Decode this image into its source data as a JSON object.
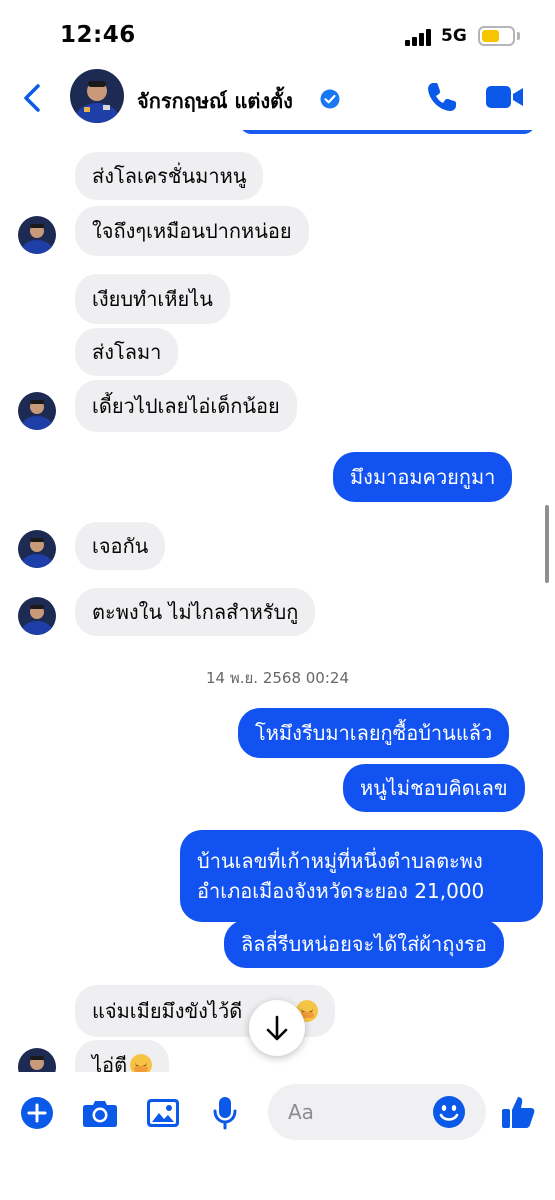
{
  "status_bar": {
    "time": "12:46",
    "network": "5G",
    "battery_level": 0.6
  },
  "header": {
    "contact_name": "จักรกฤษณ์ แต่งตั้ง",
    "verified": true
  },
  "messages": [
    {
      "dir": "in",
      "text": "ส่งโลเครชั่นมาหนู"
    },
    {
      "dir": "in",
      "text": "ใจถึงๆเหมือนปากหน่อย"
    },
    {
      "dir": "in",
      "text": "เงียบทำเหียไน"
    },
    {
      "dir": "in",
      "text": "ส่งโลมา"
    },
    {
      "dir": "in",
      "text": "เดี้ยวไปเลยไอ่เด็กน้อย"
    },
    {
      "dir": "out",
      "text": "มึงมาอมควยกูมา"
    },
    {
      "dir": "in",
      "text": "เจอกัน"
    },
    {
      "dir": "in",
      "text": "ตะพงใน  ไม่ไกลสำหรับกู"
    },
    {
      "dir": "out",
      "text": "โหมึงรีบมาเลยกูซื้อบ้านแล้ว"
    },
    {
      "dir": "out",
      "text": "หนูไม่ชอบคิดเลข"
    },
    {
      "dir": "out",
      "line1": "บ้านเลขที่เก้าหมู่ที่หนึ่งตำบลตะพง",
      "line2": "อำเภอเมืองจังหวัดระยอง 21,000"
    },
    {
      "dir": "out",
      "text": "ลิลลี่รีบหน่อยจะได้ใส่ผ้าถุงรอ"
    },
    {
      "dir": "in",
      "text": "แจ่มเมียมึงขังไว้ดี",
      "text_tail": "ะ",
      "emoji": "face-with-hand-over-mouth"
    },
    {
      "dir": "in",
      "text": "ไอ่ตี",
      "emoji": "face-with-hand-over-mouth"
    }
  ],
  "timestamp": "14 พ.ย. 2568 00:24",
  "composer": {
    "placeholder": "Aa"
  },
  "colors": {
    "accent": "#1152f0",
    "incoming_bubble": "#efeff2",
    "icon_blue": "#0a59e8"
  },
  "icons": [
    "back-arrow-icon",
    "verified-badge-icon",
    "phone-icon",
    "video-camera-icon",
    "plus-icon",
    "camera-icon",
    "image-icon",
    "microphone-icon",
    "emoji-smile-icon",
    "thumbs-up-icon",
    "arrow-down-icon"
  ]
}
